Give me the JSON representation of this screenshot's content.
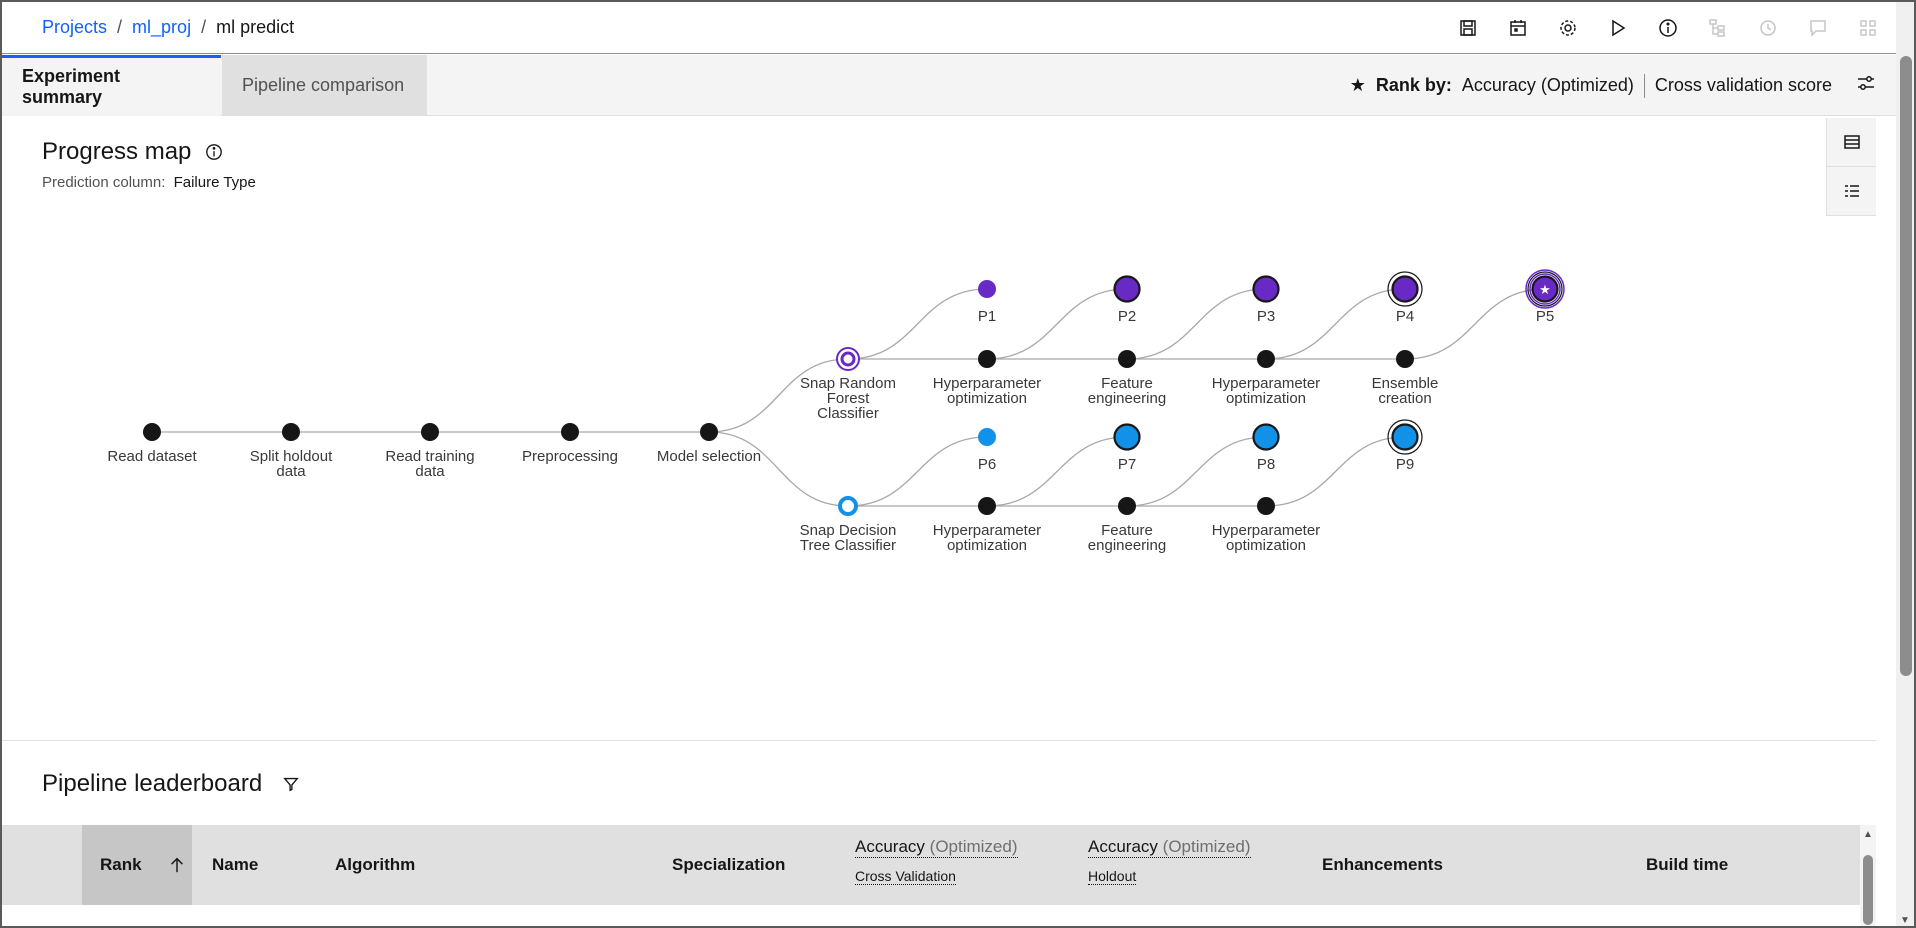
{
  "breadcrumb": {
    "projects": "Projects",
    "project": "ml_proj",
    "current": "ml predict"
  },
  "toolbar": [
    {
      "name": "save-icon"
    },
    {
      "name": "calendar-icon"
    },
    {
      "name": "settings-icon"
    },
    {
      "name": "run-icon"
    },
    {
      "name": "info-icon"
    },
    {
      "name": "flow-icon"
    },
    {
      "name": "history-icon"
    },
    {
      "name": "comments-icon"
    },
    {
      "name": "apps-icon"
    }
  ],
  "tabs": {
    "summary": "Experiment summary",
    "compare": "Pipeline comparison"
  },
  "rank_by": {
    "label": "Rank by:",
    "metric": "Accuracy (Optimized)",
    "score": "Cross validation score"
  },
  "progress": {
    "title": "Progress map",
    "pred_label": "Prediction column:",
    "pred_value": "Failure Type"
  },
  "colors": {
    "purple": "#6929c4",
    "blue": "#1192e8",
    "black": "#161616",
    "link": "#0f62fe"
  },
  "map": {
    "main_nodes": [
      {
        "lines": [
          "Read dataset"
        ]
      },
      {
        "lines": [
          "Split holdout",
          "data"
        ]
      },
      {
        "lines": [
          "Read training",
          "data"
        ]
      },
      {
        "lines": [
          "Preprocessing"
        ]
      },
      {
        "lines": [
          "Model selection"
        ]
      }
    ],
    "rf_branch": {
      "root": [
        "Snap Random",
        "Forest",
        "Classifier"
      ],
      "steps": [
        [
          "Hyperparameter",
          "optimization"
        ],
        [
          "Feature",
          "engineering"
        ],
        [
          "Hyperparameter",
          "optimization"
        ],
        [
          "Ensemble",
          "creation"
        ]
      ],
      "pipelines": [
        "P1",
        "P2",
        "P3",
        "P4",
        "P5"
      ]
    },
    "dt_branch": {
      "root": [
        "Snap Decision",
        "Tree Classifier"
      ],
      "steps": [
        [
          "Hyperparameter",
          "optimization"
        ],
        [
          "Feature",
          "engineering"
        ],
        [
          "Hyperparameter",
          "optimization"
        ]
      ],
      "pipelines": [
        "P6",
        "P7",
        "P8",
        "P9"
      ]
    }
  },
  "leaderboard": {
    "title": "Pipeline leaderboard",
    "columns": {
      "rank": "Rank",
      "name": "Name",
      "algorithm": "Algorithm",
      "specialization": "Specialization",
      "acc_cv_main": "Accuracy",
      "acc_cv_opt": "(Optimized)",
      "acc_cv_sub": "Cross Validation",
      "acc_ho_main": "Accuracy",
      "acc_ho_opt": "(Optimized)",
      "acc_ho_sub": "Holdout",
      "enhancements": "Enhancements",
      "build_time": "Build time"
    }
  }
}
